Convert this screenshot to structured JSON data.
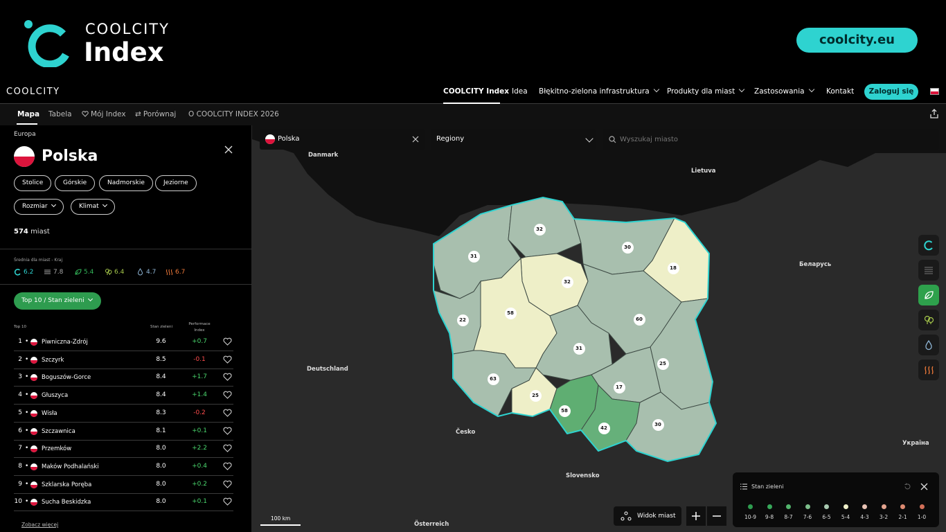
{
  "hero": {
    "logo_small": "COOLCITY",
    "logo_big": "Index",
    "site_button": "coolcity.eu"
  },
  "nav": {
    "brand": "COOLCITY",
    "items": [
      "COOLCITY Index",
      "Idea",
      "Błękitno-zielona infrastruktura",
      "Produkty dla miast",
      "Zastosowania",
      "Kontakt"
    ],
    "login": "Zaloguj się"
  },
  "subnav": {
    "items": [
      "Mapa",
      "Tabela",
      "Mój Index",
      "Porównaj",
      "O COOLCITY INDEX 2026"
    ]
  },
  "sidebar": {
    "region": "Europa",
    "country": "Polska",
    "chips": [
      "Stolice",
      "Górskie",
      "Nadmorskie",
      "Jeziorne"
    ],
    "dropdowns": [
      "Rozmiar",
      "Klimat"
    ],
    "city_count": "574",
    "city_count_label": "miast",
    "avg_label": "Średnia dla miast - Kraj",
    "averages": [
      {
        "icon": "coolcity-icon",
        "value": "6.2",
        "color": "#2ed3d0"
      },
      {
        "icon": "surface-icon",
        "value": "7.8",
        "color": "#aaaaaa"
      },
      {
        "icon": "leaf-icon",
        "value": "5.4",
        "color": "#33b75a"
      },
      {
        "icon": "tree-icon",
        "value": "6.4",
        "color": "#a6c84b"
      },
      {
        "icon": "water-drop-icon",
        "value": "4.7",
        "color": "#8fb6d6"
      },
      {
        "icon": "heat-icon",
        "value": "6.7",
        "color": "#f07a3a"
      }
    ],
    "top_button": "Top 10 / Stan zieleni",
    "table_headers": {
      "rank": "Top 10",
      "score": "Stan zieleni",
      "perf": "Performace Index"
    },
    "rows": [
      {
        "rank": "1",
        "city": "Piwniczna-Zdrój",
        "score": "9.6",
        "perf": "+0.7",
        "pos": true
      },
      {
        "rank": "2",
        "city": "Szczyrk",
        "score": "8.5",
        "perf": "-0.1",
        "pos": false
      },
      {
        "rank": "3",
        "city": "Boguszów-Gorce",
        "score": "8.4",
        "perf": "+1.7",
        "pos": true
      },
      {
        "rank": "4",
        "city": "Głuszyca",
        "score": "8.4",
        "perf": "+1.4",
        "pos": true
      },
      {
        "rank": "5",
        "city": "Wisła",
        "score": "8.3",
        "perf": "-0.2",
        "pos": false
      },
      {
        "rank": "6",
        "city": "Szczawnica",
        "score": "8.1",
        "perf": "+0.1",
        "pos": true
      },
      {
        "rank": "7",
        "city": "Przemków",
        "score": "8.0",
        "perf": "+2.2",
        "pos": true
      },
      {
        "rank": "8",
        "city": "Maków Podhalański",
        "score": "8.0",
        "perf": "+0.4",
        "pos": true
      },
      {
        "rank": "9",
        "city": "Szklarska Poręba",
        "score": "8.0",
        "perf": "+0.2",
        "pos": true
      },
      {
        "rank": "10",
        "city": "Sucha Beskidzka",
        "score": "8.0",
        "perf": "+0.1",
        "pos": true
      }
    ],
    "more_link": "Zobacz więcej"
  },
  "map": {
    "country_select": "Polska",
    "region_select": "Regiony",
    "search_placeholder": "Wyszukaj miasto",
    "labels": [
      "Danmark",
      "Lietuva",
      "Беларусь",
      "Deutschland",
      "Česko",
      "Slovensko",
      "Україна",
      "Österreich"
    ],
    "region_counts": [
      "32",
      "30",
      "31",
      "32",
      "18",
      "58",
      "22",
      "60",
      "31",
      "25",
      "63",
      "17",
      "25",
      "58",
      "42",
      "30"
    ],
    "scale": "100 km",
    "city_view": "Widok miast"
  },
  "legend": {
    "title": "Stan zieleni",
    "items": [
      {
        "label": "10-9",
        "color": "#2e9c4f"
      },
      {
        "label": "9-8",
        "color": "#37a85a"
      },
      {
        "label": "8-7",
        "color": "#52b46c"
      },
      {
        "label": "7-6",
        "color": "#7dbf8b"
      },
      {
        "label": "6-5",
        "color": "#a8c9b0"
      },
      {
        "label": "5-4",
        "color": "#eeefc8"
      },
      {
        "label": "4-3",
        "color": "#e8c3b5"
      },
      {
        "label": "3-2",
        "color": "#e3a48f"
      },
      {
        "label": "2-1",
        "color": "#dd8a71"
      },
      {
        "label": "1-0",
        "color": "#d26f58"
      }
    ]
  }
}
